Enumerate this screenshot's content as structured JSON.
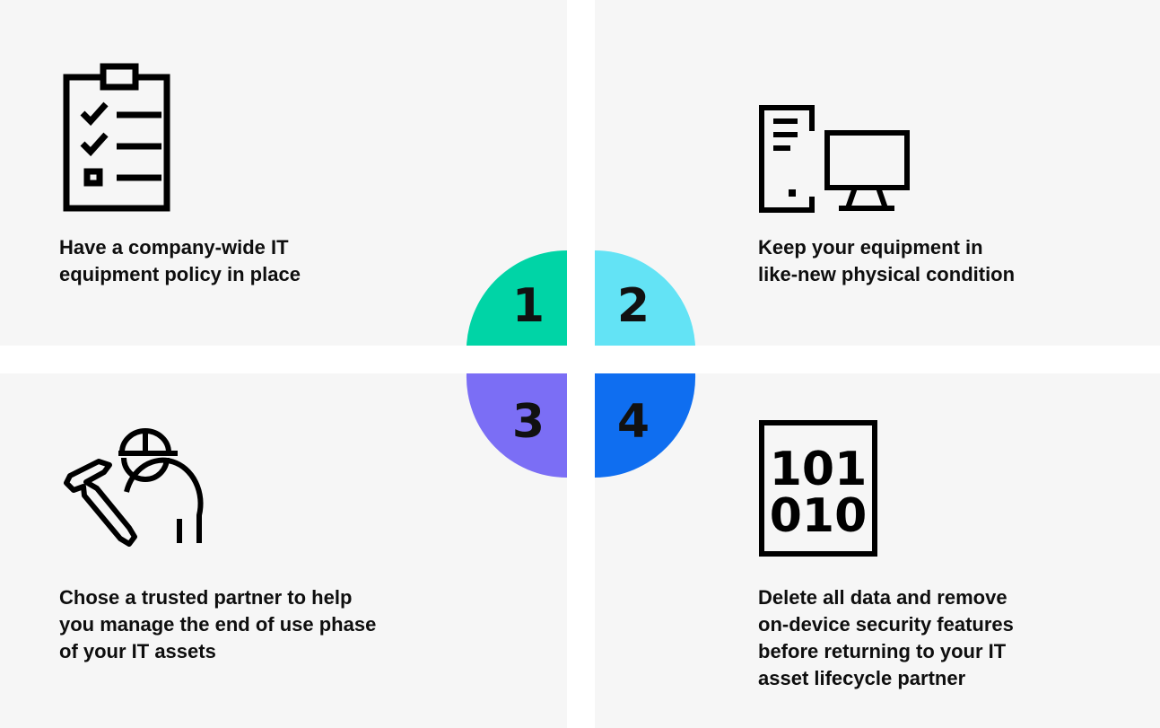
{
  "steps": [
    {
      "number": "1",
      "text": "Have a company-wide IT\nequipment policy in place",
      "color": "#00d4a6",
      "icon": "clipboard-checklist-icon"
    },
    {
      "number": "2",
      "text": "Keep your equipment in\nlike-new physical condition",
      "color": "#63e3f5",
      "icon": "desktop-computer-icon"
    },
    {
      "number": "3",
      "text": "Chose a trusted partner to help\nyou manage the end of use phase\nof your IT assets",
      "color": "#7b6ef5",
      "icon": "technician-wrench-icon"
    },
    {
      "number": "4",
      "text": "Delete all data and remove\non-device security features\nbefore returning to your IT\nasset lifecycle partner",
      "color": "#0f6ef0",
      "icon": "binary-data-icon"
    }
  ],
  "binary_icon": {
    "row1": "101",
    "row2": "010"
  }
}
